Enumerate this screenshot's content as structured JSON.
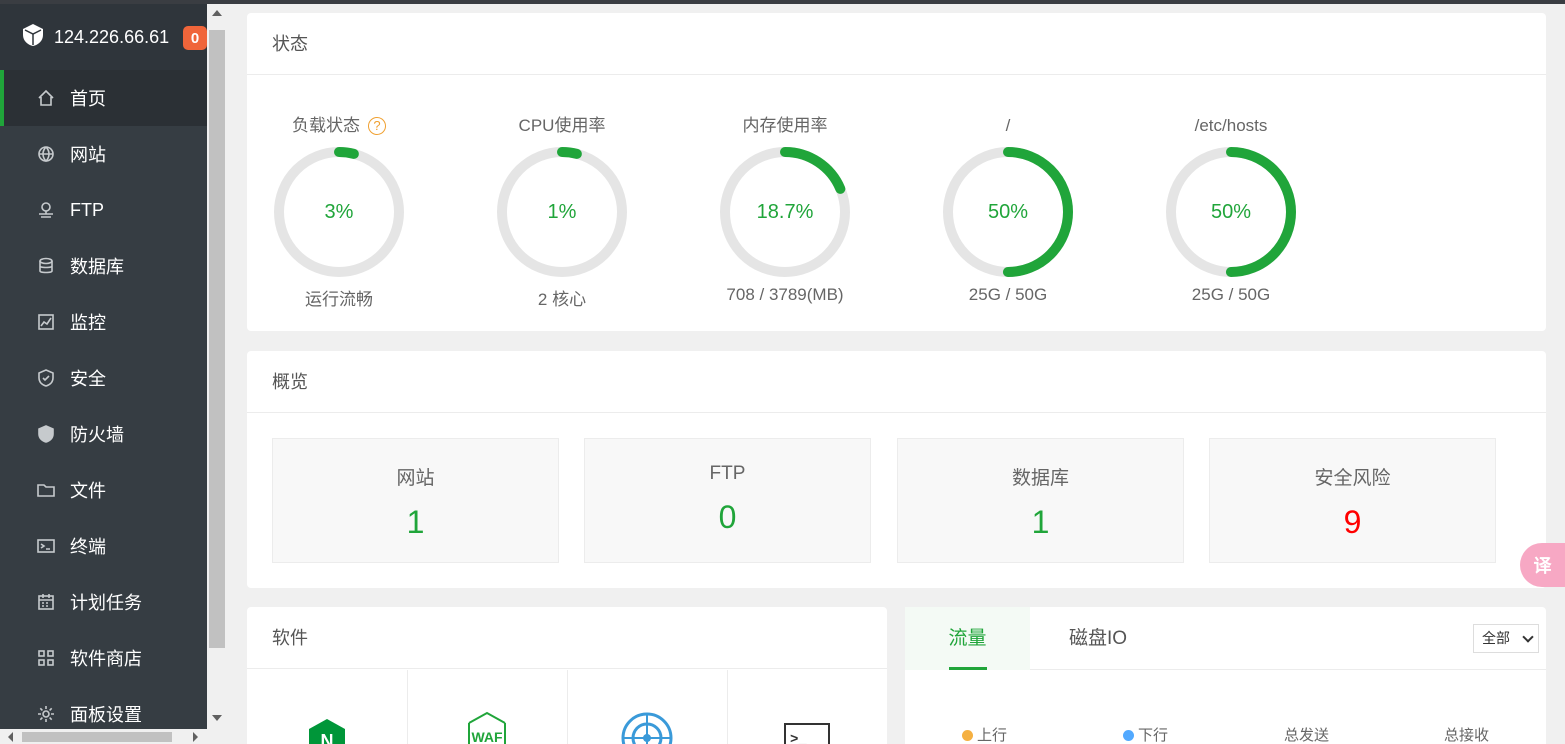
{
  "sidebar": {
    "ip": "124.226.66.61",
    "badge": "0",
    "items": [
      {
        "label": "首页",
        "icon": "home-icon"
      },
      {
        "label": "网站",
        "icon": "globe-icon"
      },
      {
        "label": "FTP",
        "icon": "ftp-icon"
      },
      {
        "label": "数据库",
        "icon": "database-icon"
      },
      {
        "label": "监控",
        "icon": "monitor-icon"
      },
      {
        "label": "安全",
        "icon": "shield-icon"
      },
      {
        "label": "防火墙",
        "icon": "firewall-icon"
      },
      {
        "label": "文件",
        "icon": "folder-icon"
      },
      {
        "label": "终端",
        "icon": "terminal-icon"
      },
      {
        "label": "计划任务",
        "icon": "calendar-icon"
      },
      {
        "label": "软件商店",
        "icon": "grid-icon"
      },
      {
        "label": "面板设置",
        "icon": "gear-icon"
      }
    ]
  },
  "status": {
    "title": "状态",
    "gauges": [
      {
        "label": "负载状态",
        "value": "3%",
        "percent": 3,
        "sub": "运行流畅",
        "help": "?"
      },
      {
        "label": "CPU使用率",
        "value": "1%",
        "percent": 1,
        "sub": "2 核心"
      },
      {
        "label": "内存使用率",
        "value": "18.7%",
        "percent": 18.7,
        "sub": "708 / 3789(MB)"
      },
      {
        "label": "/",
        "value": "50%",
        "percent": 50,
        "sub": "25G / 50G"
      },
      {
        "label": "/etc/hosts",
        "value": "50%",
        "percent": 50,
        "sub": "25G / 50G"
      }
    ]
  },
  "overview": {
    "title": "概览",
    "cards": [
      {
        "label": "网站",
        "value": "1",
        "color": "#20a53a"
      },
      {
        "label": "FTP",
        "value": "0",
        "color": "#20a53a"
      },
      {
        "label": "数据库",
        "value": "1",
        "color": "#20a53a"
      },
      {
        "label": "安全风险",
        "value": "9",
        "color": "#ff0000"
      }
    ]
  },
  "software": {
    "title": "软件",
    "apps": [
      {
        "icon": "nginx-icon",
        "short": "N"
      },
      {
        "icon": "waf-icon",
        "short": "WAF"
      },
      {
        "icon": "radar-icon"
      },
      {
        "icon": "terminal-app-icon",
        "short": ">_"
      }
    ]
  },
  "traffic": {
    "tabs": [
      "流量",
      "磁盘IO"
    ],
    "select": "全部",
    "legend": {
      "up": "上行",
      "down": "下行",
      "sent": "总发送",
      "recv": "总接收"
    },
    "colors": {
      "up": "#f5b041",
      "down": "#52a9ff"
    }
  },
  "translate_btn": "译",
  "colors": {
    "accent": "#20a53a",
    "track": "#e5e5e5",
    "danger": "#ff0000"
  }
}
